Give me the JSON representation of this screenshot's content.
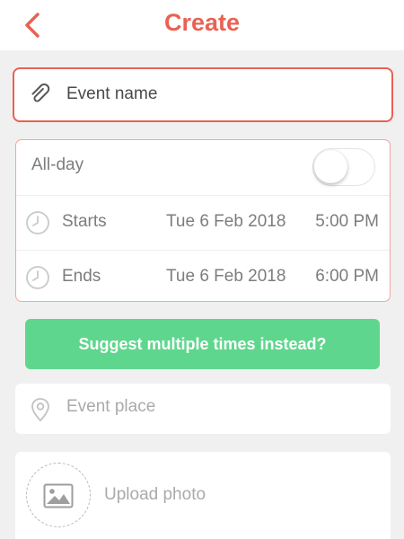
{
  "header": {
    "title": "Create",
    "back_icon": "chevron-left-icon"
  },
  "event_name": {
    "placeholder": "Event name",
    "icon": "paperclip-icon"
  },
  "time": {
    "allday_label": "All-day",
    "allday_enabled": false,
    "start": {
      "label": "Starts",
      "date": "Tue 6 Feb 2018",
      "time": "5:00 PM",
      "icon": "clock-icon"
    },
    "end": {
      "label": "Ends",
      "date": "Tue 6 Feb 2018",
      "time": "6:00 PM",
      "icon": "clock-icon"
    }
  },
  "suggest_button": {
    "label": "Suggest multiple times instead?"
  },
  "place": {
    "placeholder": "Event place",
    "icon": "location-pin-icon"
  },
  "photo": {
    "label": "Upload photo",
    "icon": "image-icon"
  },
  "colors": {
    "accent": "#e86253",
    "green": "#5fd68d",
    "border_light": "#f2a69d"
  }
}
